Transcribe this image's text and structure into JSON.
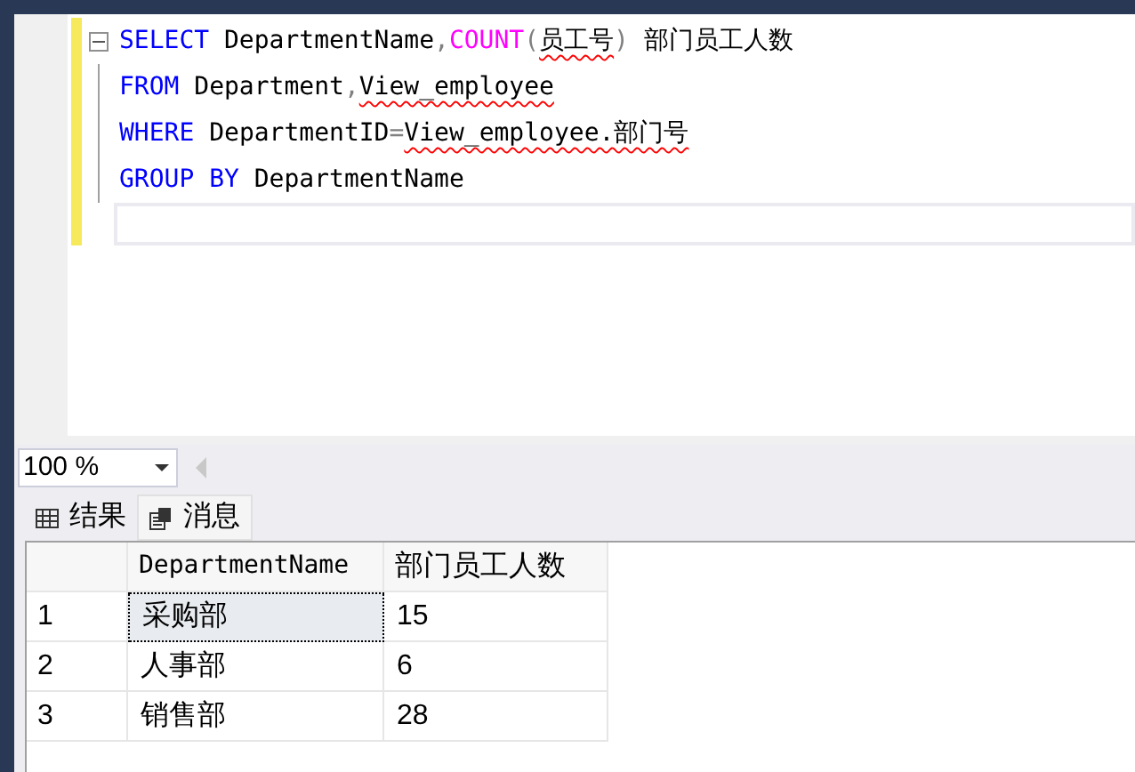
{
  "editor": {
    "lines": [
      {
        "collapsible": true,
        "tokens": [
          {
            "text": "SELECT",
            "kind": "keyword",
            "error": false
          },
          {
            "text": " DepartmentName",
            "kind": "plain",
            "error": false
          },
          {
            "text": ",",
            "kind": "operator",
            "error": false
          },
          {
            "text": "COUNT",
            "kind": "function",
            "error": false
          },
          {
            "text": "(",
            "kind": "operator",
            "error": false
          },
          {
            "text": "员工号",
            "kind": "plain",
            "error": true
          },
          {
            "text": ")",
            "kind": "operator",
            "error": false
          },
          {
            "text": " 部门员工人数",
            "kind": "plain",
            "error": false
          }
        ]
      },
      {
        "collapsible": false,
        "tokens": [
          {
            "text": "FROM",
            "kind": "keyword",
            "error": false
          },
          {
            "text": " Department",
            "kind": "plain",
            "error": false
          },
          {
            "text": ",",
            "kind": "operator",
            "error": false
          },
          {
            "text": "View_employee",
            "kind": "plain",
            "error": true
          }
        ]
      },
      {
        "collapsible": false,
        "tokens": [
          {
            "text": "WHERE",
            "kind": "keyword",
            "error": false
          },
          {
            "text": " DepartmentID",
            "kind": "plain",
            "error": false
          },
          {
            "text": "=",
            "kind": "operator",
            "error": false
          },
          {
            "text": "View_employee.部门号",
            "kind": "plain",
            "error": true
          }
        ]
      },
      {
        "collapsible": false,
        "tokens": [
          {
            "text": "GROUP BY",
            "kind": "keyword",
            "error": false
          },
          {
            "text": " DepartmentName",
            "kind": "plain",
            "error": false
          }
        ]
      }
    ]
  },
  "zoom": {
    "value": "100 %"
  },
  "result_tabs": [
    {
      "label": "结果",
      "kind": "results",
      "selected": true
    },
    {
      "label": "消息",
      "kind": "messages",
      "selected": false
    }
  ],
  "grid": {
    "columns": [
      "DepartmentName",
      "部门员工人数"
    ],
    "rows": [
      {
        "number": "1",
        "cells": [
          "采购部",
          "15"
        ],
        "selected": true
      },
      {
        "number": "2",
        "cells": [
          "人事部",
          "6"
        ],
        "selected": false
      },
      {
        "number": "3",
        "cells": [
          "销售部",
          "28"
        ],
        "selected": false
      }
    ]
  }
}
